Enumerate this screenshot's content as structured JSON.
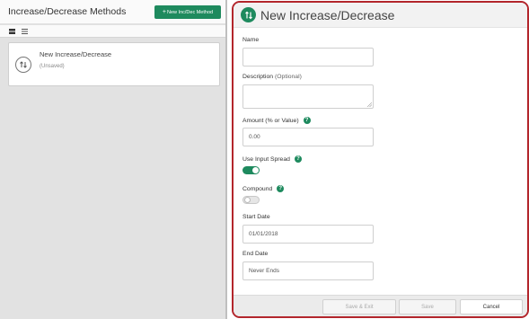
{
  "left_panel": {
    "title": "Increase/Decrease Methods",
    "new_button_label": "New Inc/Dec Method",
    "card": {
      "title": "New Increase/Decrease",
      "subtitle": "(Unsaved)"
    }
  },
  "form": {
    "title": "New Increase/Decrease",
    "name_label": "Name",
    "name_value": "",
    "description_label": "Description",
    "description_optional": "(Optional)",
    "description_value": "",
    "amount_label": "Amount (% or Value)",
    "amount_value": "0.00",
    "use_input_spread_label": "Use Input Spread",
    "use_input_spread_on": true,
    "compound_label": "Compound",
    "compound_on": false,
    "start_date_label": "Start Date",
    "start_date_value": "01/01/2018",
    "end_date_label": "End Date",
    "end_date_value": "Never Ends",
    "help_glyph": "?"
  },
  "footer": {
    "save_exit_label": "Save & Exit",
    "save_label": "Save",
    "cancel_label": "Cancel"
  },
  "colors": {
    "accent": "#1e8a5e",
    "panel_border": "#b3262c"
  }
}
